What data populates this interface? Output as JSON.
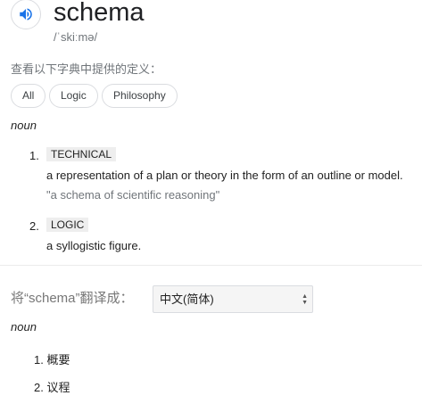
{
  "word": "schema",
  "phonetic": "/ˈskiːmə/",
  "dict_label": "查看以下字典中提供的定义：",
  "chips": [
    "All",
    "Logic",
    "Philosophy"
  ],
  "part_of_speech": "noun",
  "definitions": [
    {
      "num": "1.",
      "label": "TECHNICAL",
      "text": "a representation of a plan or theory in the form of an outline or model.",
      "example": "\"a schema of scientific reasoning\""
    },
    {
      "num": "2.",
      "label": "LOGIC",
      "text": "a syllogistic figure."
    }
  ],
  "translate": {
    "label": "将“schema”翻译成：",
    "language": "中文(简体)",
    "part_of_speech": "noun",
    "items": [
      {
        "num": "1.",
        "text": "概要"
      },
      {
        "num": "2.",
        "text": "议程"
      }
    ]
  },
  "colors": {
    "accent": "#1a73e8"
  }
}
